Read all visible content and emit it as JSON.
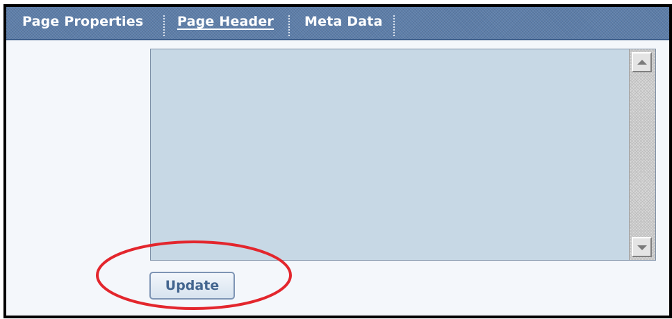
{
  "tabs": [
    {
      "label": "Page Properties",
      "active": false
    },
    {
      "label": "Page Header",
      "active": true
    },
    {
      "label": "Meta Data",
      "active": false
    }
  ],
  "editor": {
    "value": ""
  },
  "actions": {
    "update_label": "Update"
  },
  "colors": {
    "tab_bar": "#5d7ea9",
    "textarea_bg": "#c7d8e5",
    "annotation": "#e3262d"
  }
}
